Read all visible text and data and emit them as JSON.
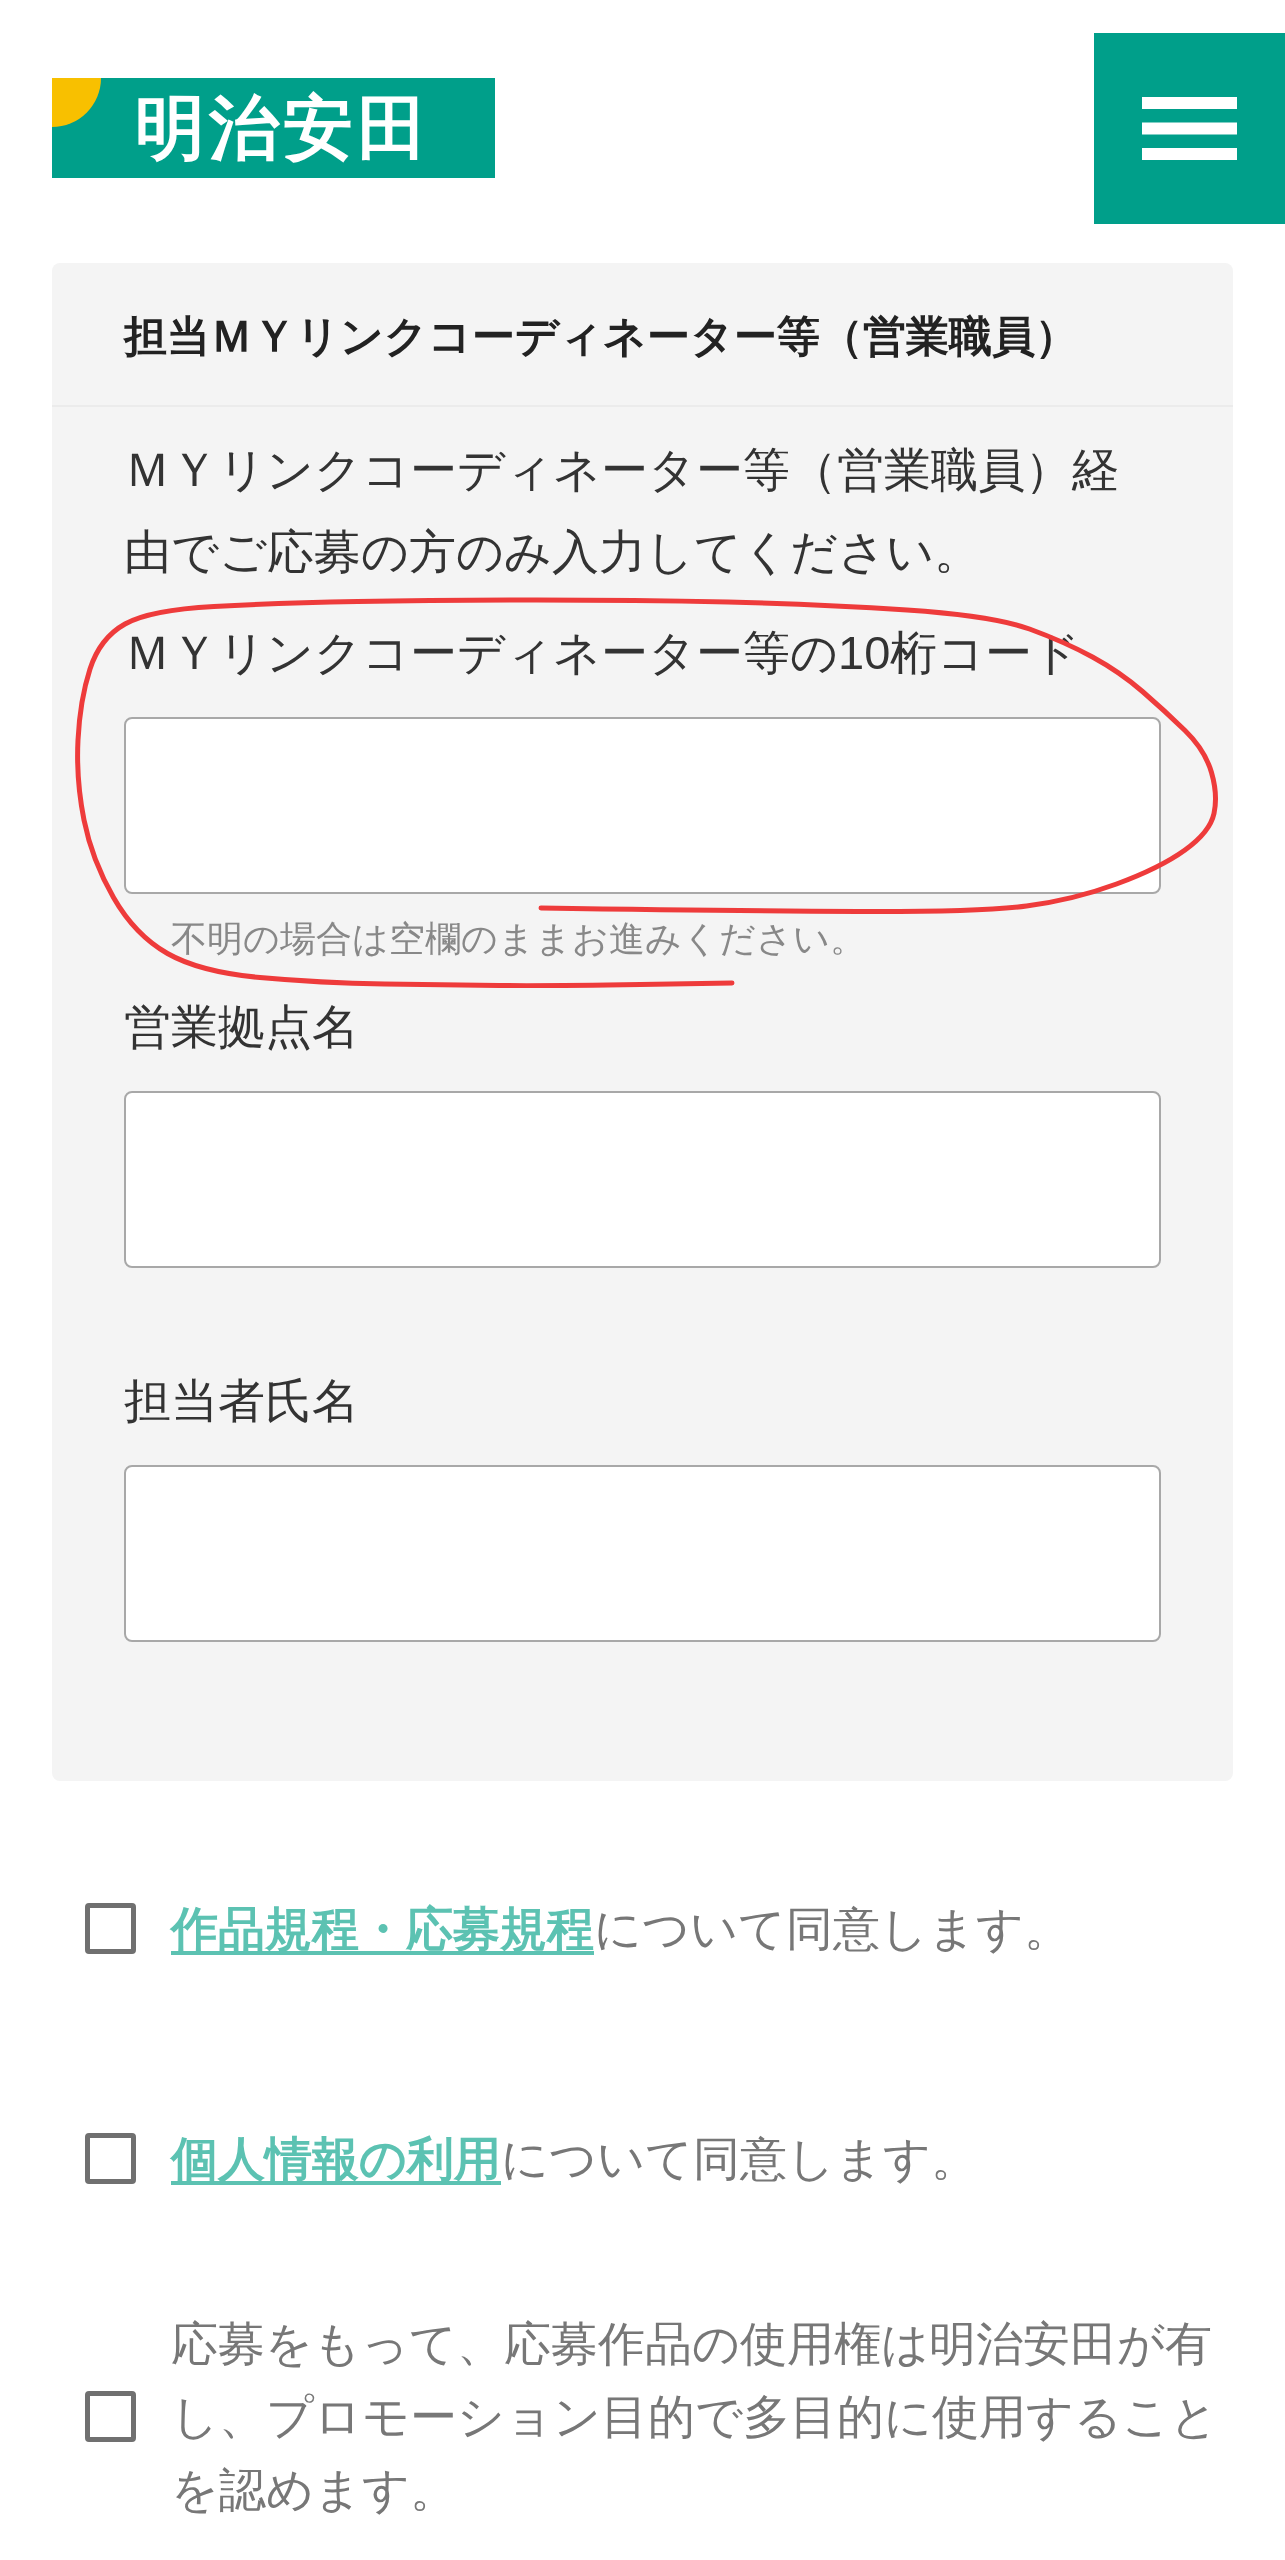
{
  "header": {
    "logo_text": "明治安田"
  },
  "section": {
    "title": "担当ＭＹリンクコーディネーター等（営業職員）",
    "description": "ＭＹリンクコーディネーター等（営業職員）経由でご応募の方のみ入力してください。",
    "fields": [
      {
        "label": "ＭＹリンクコーディネーター等の10桁コード",
        "hint": "不明の場合は空欄のままお進みください。"
      },
      {
        "label": "営業拠点名"
      },
      {
        "label": "担当者氏名"
      }
    ]
  },
  "agreements": [
    {
      "link": "作品規程・応募規程",
      "text": "について同意します。",
      "checked": false
    },
    {
      "link": "個人情報の利用",
      "text": "について同意します。",
      "checked": false
    },
    {
      "text": "応募をもって、応募作品の使用権は明治安田が有し、プロモーション目的で多目的に使用することを認めます。",
      "checked": false
    }
  ]
}
